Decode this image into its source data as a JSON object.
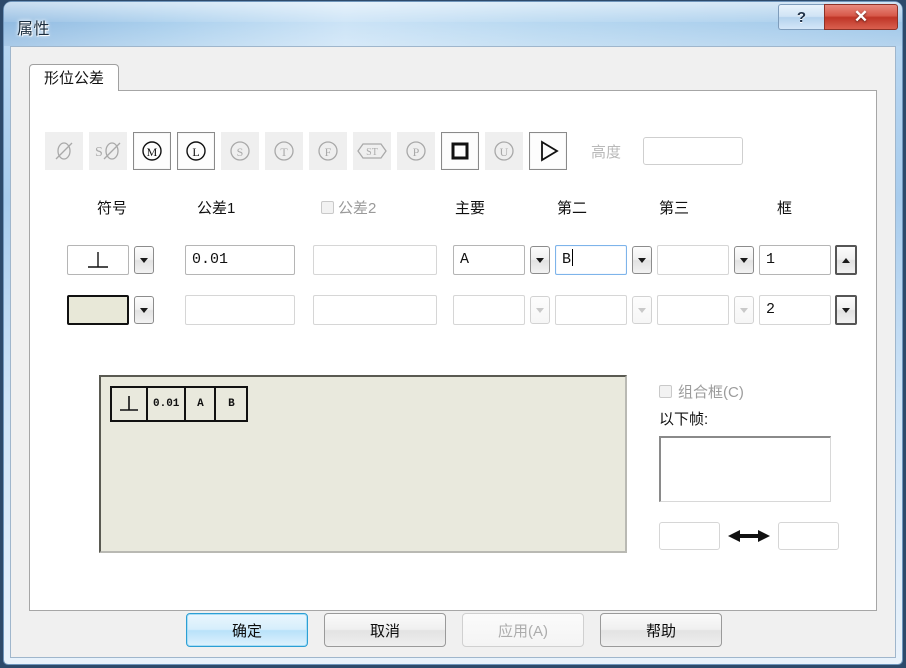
{
  "window": {
    "title": "属性",
    "help_button": "?",
    "close_button": "✕"
  },
  "tab": {
    "label": "形位公差"
  },
  "symbols": {
    "items": [
      {
        "name": "diameter",
        "glyph": "Ø",
        "active": false
      },
      {
        "name": "spherical-diameter",
        "glyph": "SØ",
        "active": false
      },
      {
        "name": "mmc-m",
        "glyph": "M",
        "active": true
      },
      {
        "name": "lmc-l",
        "glyph": "L",
        "active": true
      },
      {
        "name": "rfs-s",
        "glyph": "S",
        "active": false
      },
      {
        "name": "tangent-plane-t",
        "glyph": "T",
        "active": false
      },
      {
        "name": "free-state-f",
        "glyph": "F",
        "active": false
      },
      {
        "name": "statistical-st",
        "glyph": "ST",
        "active": false
      },
      {
        "name": "projected-p",
        "glyph": "P",
        "active": false
      },
      {
        "name": "square-frame",
        "glyph": "□",
        "active": true
      },
      {
        "name": "unequal-u",
        "glyph": "U",
        "active": false
      },
      {
        "name": "triangle-datum",
        "glyph": "▷",
        "active": true
      }
    ],
    "height_label": "高度",
    "height_value": "",
    "height_placeholder": ""
  },
  "columns": [
    {
      "key": "symbol",
      "header": "符号",
      "checkbox": false,
      "disabled": false
    },
    {
      "key": "tol1",
      "header": "公差1",
      "checkbox": false,
      "disabled": false
    },
    {
      "key": "tol2",
      "header": "公差2",
      "checkbox": true,
      "disabled": true
    },
    {
      "key": "primary",
      "header": "主要",
      "checkbox": false,
      "disabled": false
    },
    {
      "key": "second",
      "header": "第二",
      "checkbox": false,
      "disabled": false
    },
    {
      "key": "third",
      "header": "第三",
      "checkbox": false,
      "disabled": false
    },
    {
      "key": "frame",
      "header": "框",
      "checkbox": false,
      "disabled": false
    }
  ],
  "rows": [
    {
      "symbol_glyph": "⊥",
      "symbol_kind": "perpendicularity",
      "tol1": "0.01",
      "tol2": "",
      "primary": "A",
      "second": "B",
      "second_focused": true,
      "third": "",
      "frame": "1",
      "frame_spin": "up"
    },
    {
      "symbol_glyph": "",
      "symbol_kind": "swatch",
      "tol1": "",
      "tol2": "",
      "primary": "",
      "second": "",
      "second_focused": false,
      "third": "",
      "frame": "2",
      "frame_spin": "down"
    }
  ],
  "preview": {
    "frame_cells": [
      "⊥",
      "0.01",
      "A",
      "B"
    ]
  },
  "right_panel": {
    "combine_label": "组合框(C)",
    "combine_checked": false,
    "combine_disabled": true,
    "below_label": "以下帧:",
    "list_items": [],
    "left_value": "",
    "right_value": "",
    "arrow_icon": "double-arrow"
  },
  "footer": {
    "buttons": [
      {
        "name": "ok-button",
        "label": "确定",
        "state": "default"
      },
      {
        "name": "cancel-button",
        "label": "取消",
        "state": "normal"
      },
      {
        "name": "apply-button",
        "label": "应用(A)",
        "state": "disabled"
      },
      {
        "name": "help-button",
        "label": "帮助",
        "state": "normal"
      }
    ]
  },
  "colors": {
    "title_gradient_start": "#8cb8e0",
    "close_red": "#bf3527",
    "preview_bg": "#e9e9dd",
    "default_button_border": "#2c9fd4"
  }
}
